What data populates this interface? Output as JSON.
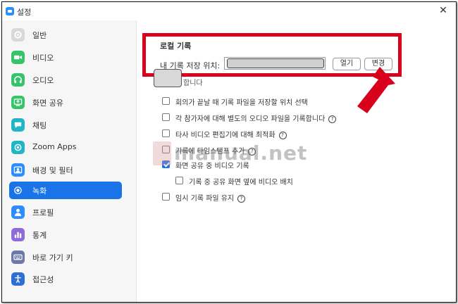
{
  "window": {
    "title": "설정",
    "close_glyph": "✕"
  },
  "sidebar": {
    "items": [
      {
        "label": "일반",
        "icon": "gear-icon",
        "color": "#d9d9d9"
      },
      {
        "label": "비디오",
        "icon": "camera-icon",
        "color": "#35c46a"
      },
      {
        "label": "오디오",
        "icon": "headphones-icon",
        "color": "#35c46a"
      },
      {
        "label": "화면 공유",
        "icon": "share-screen-icon",
        "color": "#35c46a"
      },
      {
        "label": "채팅",
        "icon": "chat-icon",
        "color": "#20b6c7"
      },
      {
        "label": "Zoom Apps",
        "icon": "apps-icon",
        "color": "#20b6c7"
      },
      {
        "label": "배경 및 필터",
        "icon": "background-icon",
        "color": "#2d8cff"
      },
      {
        "label": "녹화",
        "icon": "record-icon",
        "color": "#1a73e8",
        "active": true
      },
      {
        "label": "프로필",
        "icon": "profile-icon",
        "color": "#2d8cff"
      },
      {
        "label": "통계",
        "icon": "stats-icon",
        "color": "#8e6bd8"
      },
      {
        "label": "바로 가기 키",
        "icon": "keyboard-icon",
        "color": "#6b78a8"
      },
      {
        "label": "접근성",
        "icon": "accessibility-icon",
        "color": "#2d6fd6"
      }
    ]
  },
  "recording": {
    "section_title": "로컬 기록",
    "location_label": "내 기록 저장 위치:",
    "open_button": "열기",
    "change_button": "변경",
    "partial_text": "합니다",
    "options": [
      {
        "label": "회의가 끝날 때 기록 파일을 저장할 위치 선택",
        "checked": false,
        "help": false
      },
      {
        "label": "각 참가자에 대해 별도의 오디오 파일을 기록합니다",
        "checked": false,
        "help": true
      },
      {
        "label": "타사 비디오 편집기에 대해 최적화",
        "checked": false,
        "help": true
      },
      {
        "label": "기록에 타임스탬프 추가",
        "checked": false,
        "help": true
      },
      {
        "label": "화면 공유 중 비디오 기록",
        "checked": true,
        "help": false
      },
      {
        "label": "기록 중 공유 화면 옆에 비디오 배치",
        "checked": false,
        "help": false,
        "indent": true
      },
      {
        "label": "임시 기록 파일 유지",
        "checked": false,
        "help": true
      }
    ]
  },
  "watermark": {
    "text": "manual.net"
  },
  "colors": {
    "accent": "#1a73e8",
    "highlight": "#d9001b"
  }
}
